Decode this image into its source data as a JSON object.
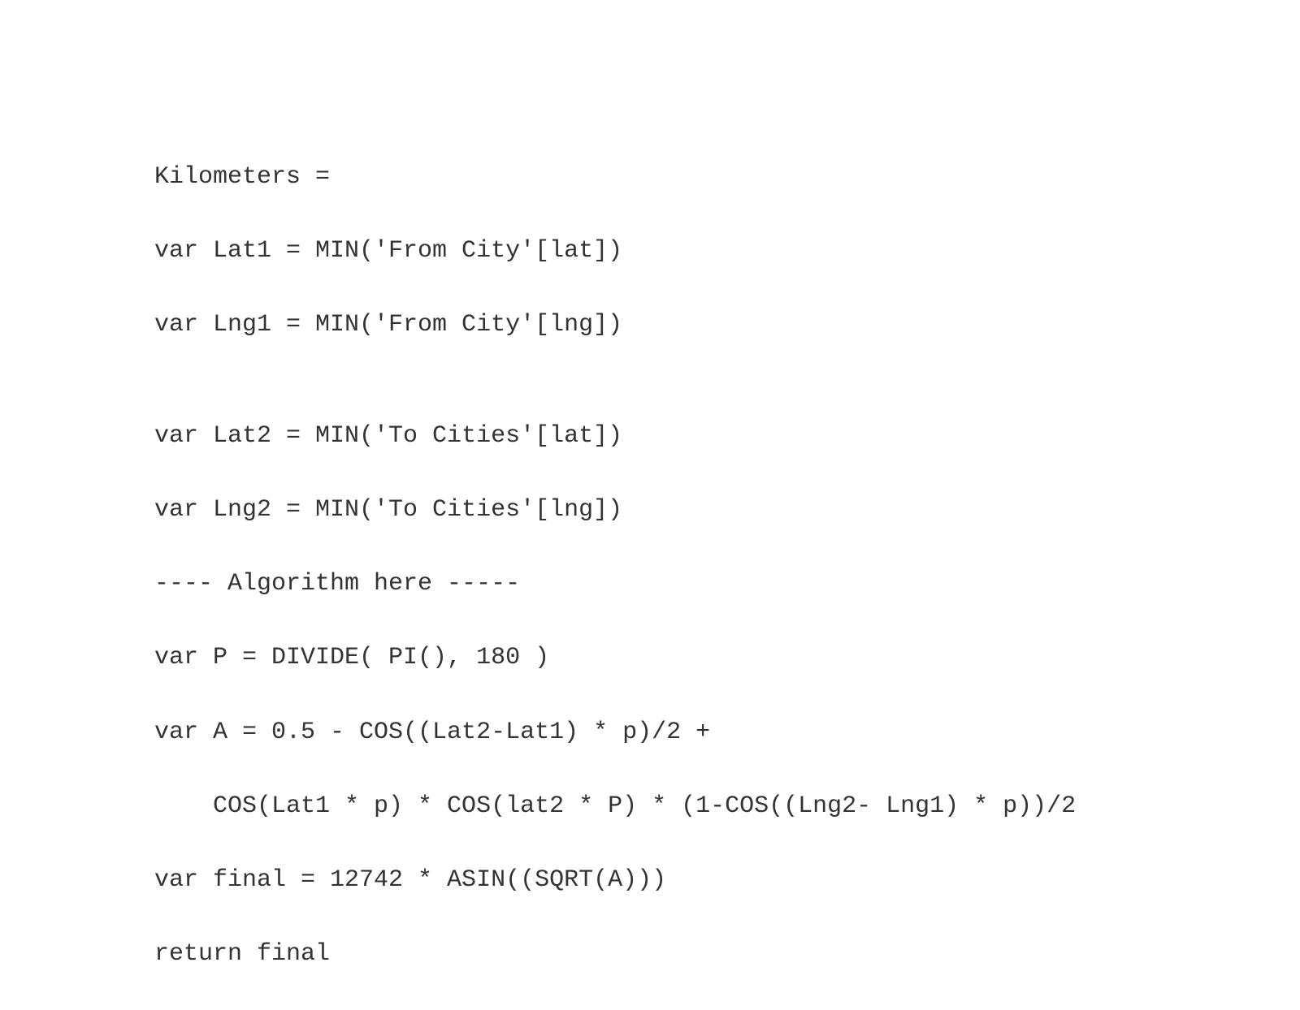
{
  "code": {
    "lines": [
      "Kilometers =",
      "var Lat1 = MIN('From City'[lat])",
      "var Lng1 = MIN('From City'[lng])",
      "",
      "var Lat2 = MIN('To Cities'[lat])",
      "var Lng2 = MIN('To Cities'[lng])",
      "---- Algorithm here -----",
      "var P = DIVIDE( PI(), 180 )",
      "var A = 0.5 - COS((Lat2-Lat1) * p)/2 +",
      "    COS(Lat1 * p) * COS(lat2 * P) * (1-COS((Lng2- Lng1) * p))/2",
      "var final = 12742 * ASIN((SQRT(A)))",
      "return final"
    ]
  }
}
